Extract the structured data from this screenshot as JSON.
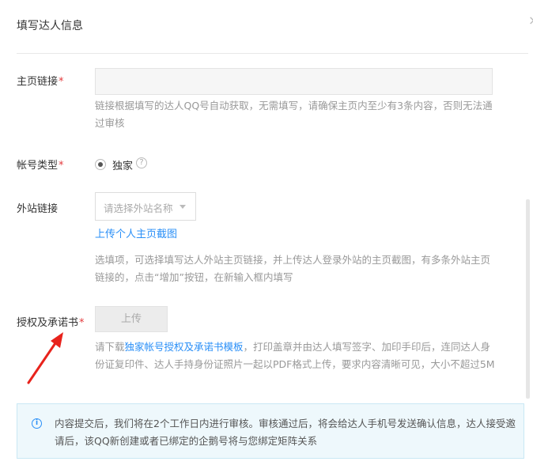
{
  "dialog": {
    "title": "填写达人信息",
    "close_glyph": "×"
  },
  "homepage": {
    "label": "主页链接",
    "required_mark": "*",
    "hint": "链接根据填写的达人QQ号自动获取，无需填写，请确保主页内至少有3条内容，否则无法通过审核"
  },
  "account_type": {
    "label": "帐号类型",
    "required_mark": "*",
    "option": "独家",
    "help_glyph": "?"
  },
  "external": {
    "label": "外站链接",
    "select_placeholder": "请选择外站名称",
    "upload_link": "上传个人主页截图",
    "hint": "选填项，可选择填写达人外站主页链接，并上传达人登录外站的主页截图，有多条外站主页链接的，点击“增加”按钮，在新输入框内填写"
  },
  "authorization": {
    "label": "授权及承诺书",
    "required_mark": "*",
    "upload_button": "上传",
    "hint_prefix": "请下载",
    "hint_link": "独家帐号授权及承诺书模板",
    "hint_suffix": "，打印盖章并由达人填写签字、加印手印后，连同达人身份证复印件、达人手持身份证照片一起以PDF格式上传，要求内容清晰可见，大小不超过5M"
  },
  "notice": {
    "info_glyph": "i",
    "text": "内容提交后，我们将在2个工作日内进行审核。审核通过后，将会给达人手机号发送确认信息，达人接受邀请后，该QQ新创建或者已绑定的企鹅号将与您绑定矩阵关系"
  },
  "colors": {
    "accent": "#2a8ff7",
    "required": "#e4393c",
    "arrow": "#e8231c"
  }
}
